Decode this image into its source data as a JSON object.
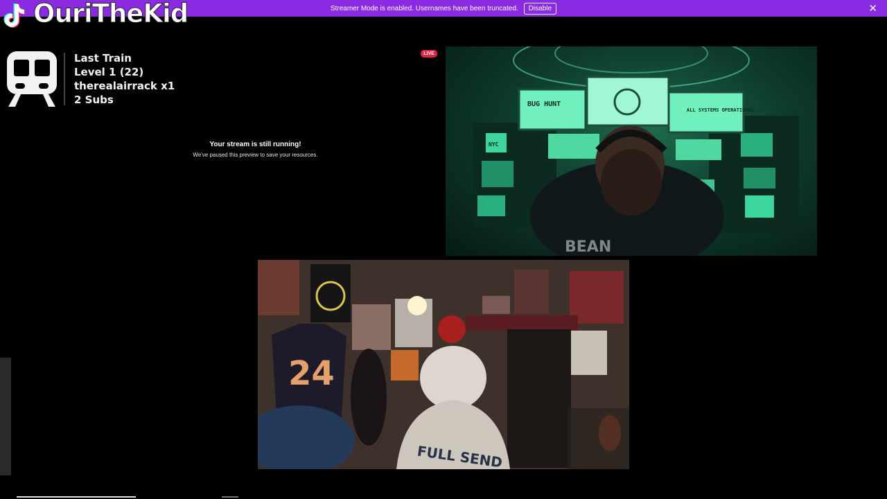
{
  "banner": {
    "message": "Streamer Mode is enabled. Usernames have been truncated.",
    "disable_label": "Disable",
    "close_glyph": "✕",
    "color": "#8a2be2"
  },
  "brand": {
    "icon": "tiktok-icon",
    "name": "OuriTheKid"
  },
  "train_widget": {
    "icon": "train-icon",
    "title": "Last Train",
    "level": "Level 1  (22)",
    "user": "therealairrack x1",
    "subs": "2 Subs"
  },
  "preview_notice": {
    "title": "Your stream is still running!",
    "subtitle": "We've paused this preview to save your resources."
  },
  "live_badge": {
    "label": "LIVE",
    "color": "#e02443"
  },
  "video_top": {
    "screens": [
      "BUG HUNT",
      "ALL SYSTEMS OPERATIONAL",
      "NYC"
    ]
  },
  "video_bottom": {
    "jersey_number": "24",
    "hoodie_text": "FULL SEND"
  }
}
